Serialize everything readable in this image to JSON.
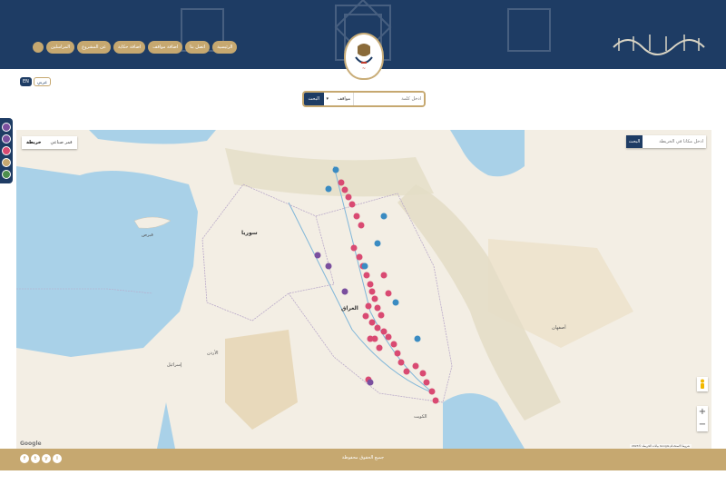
{
  "header": {
    "logo_alt": "emblem",
    "calligraphy": "الملتقى الإسلامي العراقي"
  },
  "nav": {
    "items": [
      {
        "label": "الرئيسية"
      },
      {
        "label": "اتصل بنا"
      },
      {
        "label": "اضافة مواقف"
      },
      {
        "label": "اضافة حكاية"
      },
      {
        "label": "عن المشروع"
      },
      {
        "label": "المراسلين"
      }
    ]
  },
  "language": {
    "en": "EN",
    "ar": "عربي"
  },
  "search": {
    "button": "البحث",
    "select_value": "مواقف",
    "placeholder": "ادخل كلمة"
  },
  "map": {
    "type_map": "خريطة",
    "type_satellite": "قمر صناعي",
    "search_button": "البحث",
    "search_placeholder": "ادخل مكانا في الخريطة",
    "google": "Google",
    "attribution": "بيانات الخريطة ©2023 Google شروط الاستخدام",
    "labels": {
      "syria": "سوريا",
      "iraq": "العراق",
      "jordan": "الأردن",
      "kuwait": "الكويت",
      "israel": "إسرائيل",
      "cyprus": "قبرص",
      "isfahan": "أصفهان"
    },
    "marker_colors": {
      "red": "#d94a72",
      "purple": "#7a4f9e",
      "blue": "#3a8bc2"
    }
  },
  "legend": {
    "colors": [
      "#7a4f9e",
      "#7a4f9e",
      "#d94a72",
      "#c6a870",
      "#4d8f4d"
    ]
  },
  "footer": {
    "copyright": "جميع الحقوق محفوظة",
    "social": [
      "f",
      "t",
      "y",
      "i"
    ]
  }
}
